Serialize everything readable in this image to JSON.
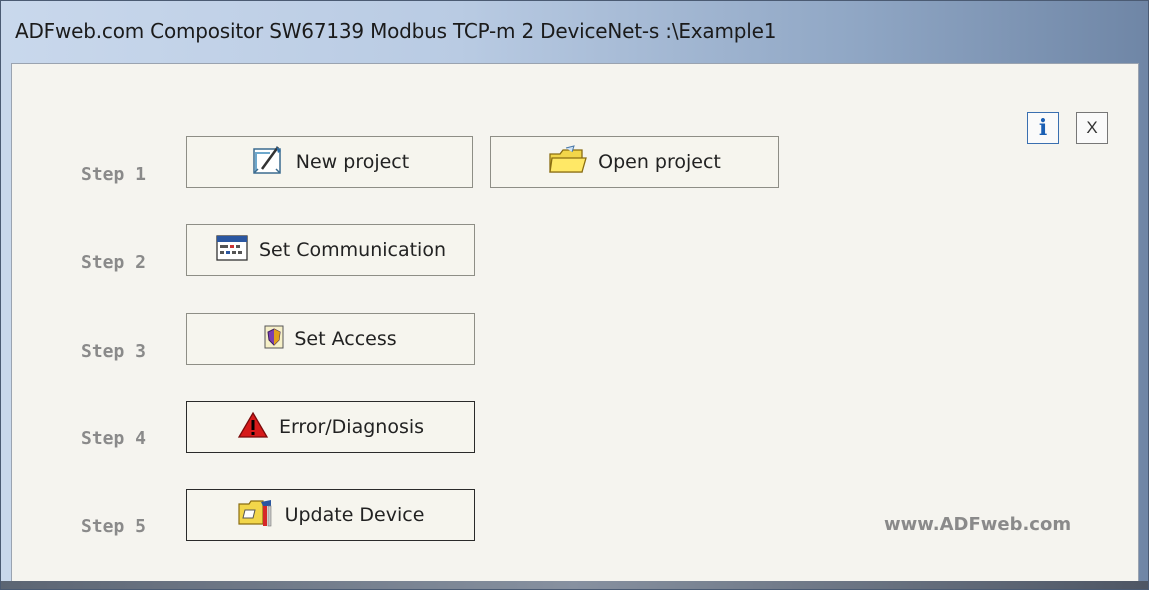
{
  "window": {
    "title": "ADFweb.com Compositor SW67139 Modbus TCP-m 2 DeviceNet-s :\\Example1"
  },
  "header_buttons": {
    "info_label": "i",
    "close_label": "X"
  },
  "steps": [
    {
      "label": "Step 1"
    },
    {
      "label": "Step 2"
    },
    {
      "label": "Step 3"
    },
    {
      "label": "Step 4"
    },
    {
      "label": "Step 5"
    }
  ],
  "buttons": {
    "new_project": "New project",
    "open_project": "Open project",
    "set_communication": "Set Communication",
    "set_access": "Set Access",
    "error_diagnosis": "Error/Diagnosis",
    "update_device": "Update Device"
  },
  "footer": {
    "website": "www.ADFweb.com"
  },
  "colors": {
    "client_bg": "#f5f4ef",
    "step_label": "#8a8a8a",
    "info_blue": "#1a5fb4"
  }
}
